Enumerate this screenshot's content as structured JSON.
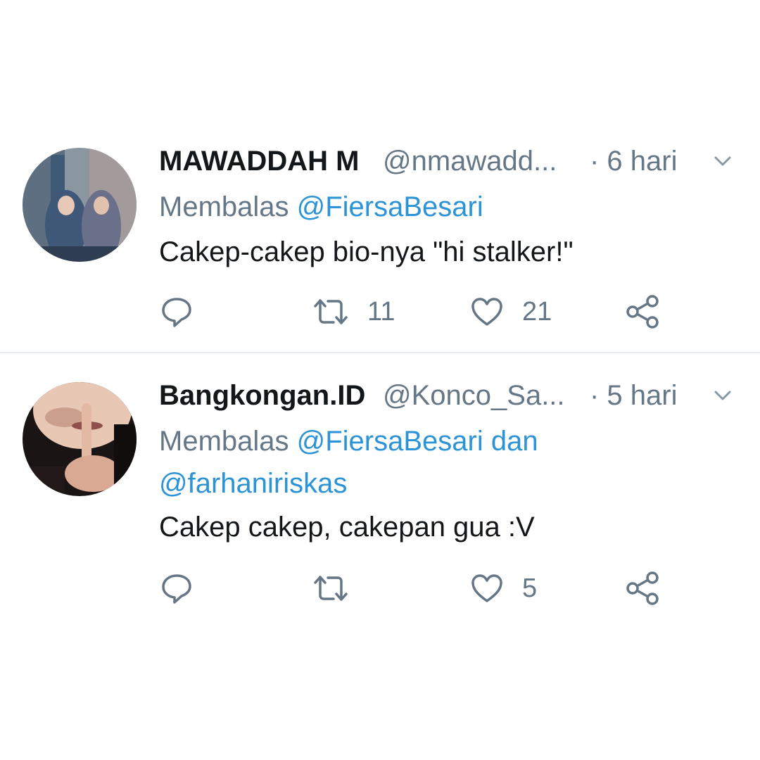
{
  "tweets": [
    {
      "name": "MAWADDAH M",
      "handle": "@nmawadd...",
      "time": "· 6 hari",
      "reply_prefix": "Membalas ",
      "reply_mentions": [
        "@FiersaBesari"
      ],
      "text": "Cakep-cakep bio-nya \"hi stalker!\"",
      "retweet_count": "11",
      "like_count": "21"
    },
    {
      "name": "Bangkongan.ID",
      "handle": "@Konco_Sa...",
      "time": "· 5 hari",
      "reply_prefix": "Membalas ",
      "reply_mentions": [
        "@FiersaBesari",
        "@farhaniriskas"
      ],
      "reply_joiner": " dan ",
      "text": "Cakep cakep, cakepan gua :V",
      "retweet_count": "",
      "like_count": "5"
    }
  ],
  "icons": {
    "reply": "reply-icon",
    "retweet": "retweet-icon",
    "like": "heart-icon",
    "share": "share-icon",
    "menu": "chevron-down-icon"
  },
  "colors": {
    "text": "#14171a",
    "secondary": "#657786",
    "link": "#2b93d6",
    "divider": "#e6ecf0"
  }
}
